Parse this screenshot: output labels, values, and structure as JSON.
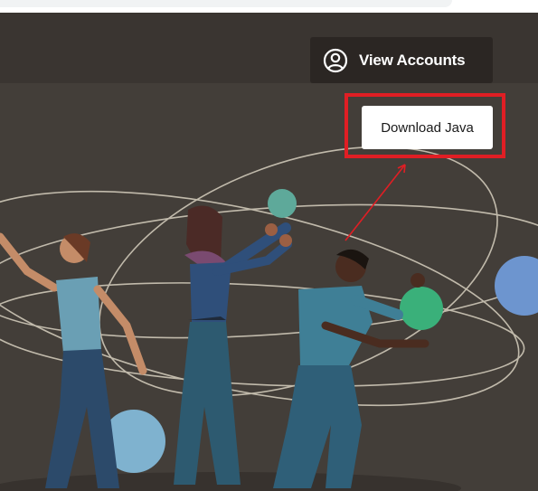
{
  "header": {
    "view_accounts_label": "View Accounts",
    "view_accounts_icon": "user-circle-icon"
  },
  "hero": {
    "download_label": "Download Java",
    "illustration": "people-juggling-planets-illustration"
  },
  "annotation": {
    "highlight_color": "#e01e24"
  },
  "colors": {
    "header_bg": "#3a3531",
    "hero_bg": "#433e39",
    "button_dark": "#2b2623"
  }
}
